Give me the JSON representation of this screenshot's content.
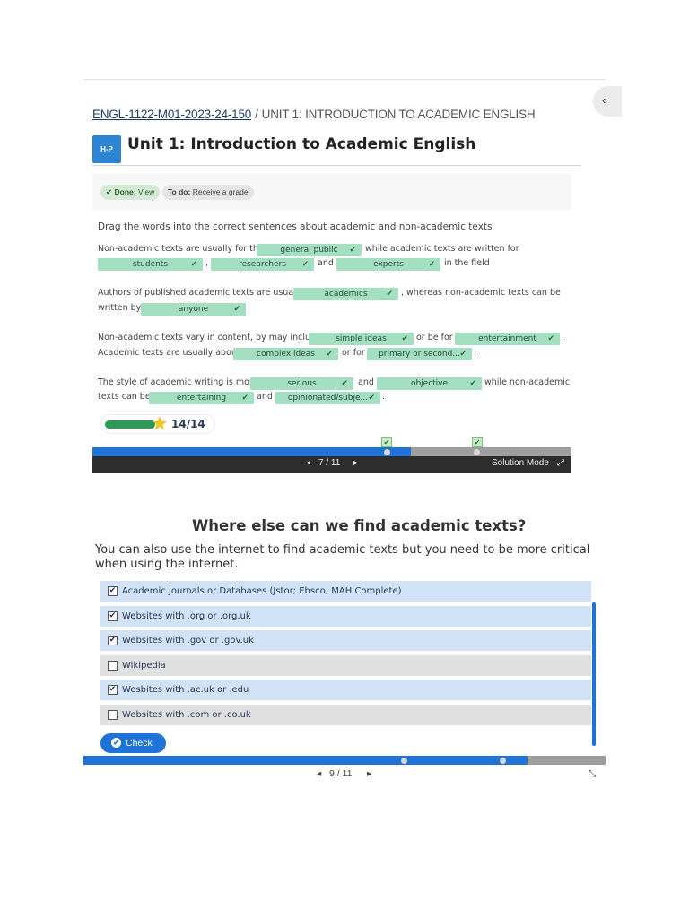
{
  "panel1": {
    "breadcrumb": {
      "course": "ENGL-1122-M01-2023-24-150",
      "separator": "/",
      "unit": "UNIT 1: INTRODUCTION TO ACADEMIC ENGLISH"
    },
    "collapse_icon": "chevron-left-icon",
    "collapse_glyph": "‹",
    "logo_text": "H-P",
    "title": "Unit 1: Introduction to Academic English",
    "status": {
      "done_label": "Done:",
      "done_value": "View",
      "todo_label": "To do:",
      "todo_value": "Receive a grade"
    },
    "instruction": "Drag the words into the correct sentences about academic and non-academic texts",
    "q1": {
      "t1": "Non-academic texts are usually for the",
      "a1": "general public",
      "t2": "while academic texts are written for",
      "a2": "students",
      "t3": ",",
      "a3": "researchers",
      "t4": "and",
      "a4": "experts",
      "t5": "in the field"
    },
    "q2": {
      "t1": "Authors of published academic texts are usually",
      "a1": "academics",
      "t2": ", whereas non-academic texts can be",
      "t3": "written by",
      "a2": "anyone"
    },
    "q3": {
      "t1": "Non-academic texts vary in content, by may include",
      "a1": "simple ideas",
      "t2": "or be for",
      "a2": "entertainment",
      "t3": ".",
      "t4": "Academic texts are usually about",
      "a3": "complex ideas",
      "t5": "or for",
      "a4": "primary or second...",
      "t6": "."
    },
    "q4": {
      "t1": "The style of academic writing is more",
      "a1": "serious",
      "t2": "and",
      "a2": "objective",
      "t3": "while non-academic",
      "t4": "texts can be",
      "a3": "entertaining",
      "t5": "and",
      "a4": "opinionated/subje...",
      "t6": "."
    },
    "check_glyph": "✔",
    "score": "14/14",
    "score_fraction": 1.0,
    "star_icon": "star-icon",
    "star_glyph": "★",
    "nav": {
      "prev_glyph": "◂",
      "page": "7 / 11",
      "next_glyph": "▸",
      "mode": "Solution Mode",
      "expand_glyph": "⤢"
    }
  },
  "panel2": {
    "title": "Where else can we find academic texts?",
    "intro": "You can also use the internet to find academic texts but you need to be more critical when using the internet.",
    "options": [
      {
        "label": "Academic Journals or Databases (Jstor; Ebsco; MAH Complete)",
        "checked": true
      },
      {
        "label": "Websites with .org or .org.uk",
        "checked": true
      },
      {
        "label": "Websites with .gov or .gov.uk",
        "checked": true
      },
      {
        "label": "Wikipedia",
        "checked": false
      },
      {
        "label": "Wesbites with .ac.uk or .edu",
        "checked": true
      },
      {
        "label": "Websites with .com or .co.uk",
        "checked": false
      }
    ],
    "check_mark": "✔",
    "check_button": "Check",
    "nav": {
      "prev_glyph": "◂",
      "page": "9 / 11",
      "next_glyph": "▸",
      "collapse_glyph": "⤡"
    }
  },
  "colors": {
    "accent_blue": "#1f73d8",
    "answer_green": "#a3dfc0",
    "score_green": "#2e9a58",
    "selected_option": "#d2e3f7",
    "unselected_option": "#e0e0e0",
    "footer_dark": "#2d2d2d"
  }
}
